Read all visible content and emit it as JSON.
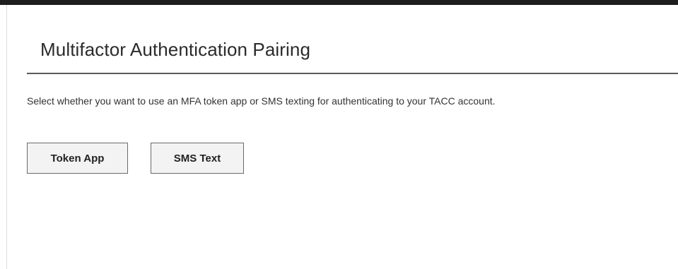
{
  "header": {
    "title": "Multifactor Authentication Pairing"
  },
  "main": {
    "instructions": "Select whether you want to use an MFA token app or SMS texting for authenticating to your TACC account.",
    "buttons": [
      {
        "label": "Token App"
      },
      {
        "label": "SMS Text"
      }
    ]
  },
  "colors": {
    "top_bar": "#1e1e1e",
    "divider": "#5a5a5a",
    "button_background": "#f3f3f3",
    "button_border": "#6a6a6a"
  }
}
